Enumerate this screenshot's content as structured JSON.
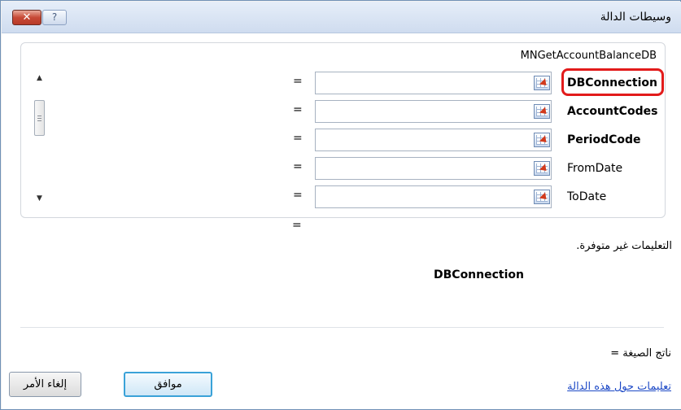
{
  "window": {
    "title": "وسيطات الدالة",
    "close_label": "✕",
    "help_label": "?"
  },
  "function": {
    "name": "MNGetAccountBalanceDB"
  },
  "arguments": [
    {
      "label": "DBConnection",
      "value": "",
      "required": true,
      "highlighted": true
    },
    {
      "label": "AccountCodes",
      "value": "",
      "required": true,
      "highlighted": false
    },
    {
      "label": "PeriodCode",
      "value": "",
      "required": true,
      "highlighted": false
    },
    {
      "label": "FromDate",
      "value": "",
      "required": false,
      "highlighted": false
    },
    {
      "label": "ToDate",
      "value": "",
      "required": false,
      "highlighted": false
    }
  ],
  "equals_sign": "=",
  "result_equals": "=",
  "description": "التعليمات غير متوفرة.",
  "current_argument": "DBConnection",
  "formula_result": "ناتج الصيغة =",
  "help_link": "تعليمات حول هذه الدالة",
  "buttons": {
    "ok": "موافق",
    "cancel": "إلغاء الأمر"
  },
  "colors": {
    "highlight": "#e21b1b",
    "link": "#1d49c6",
    "ok_border": "#3aa2d8"
  }
}
